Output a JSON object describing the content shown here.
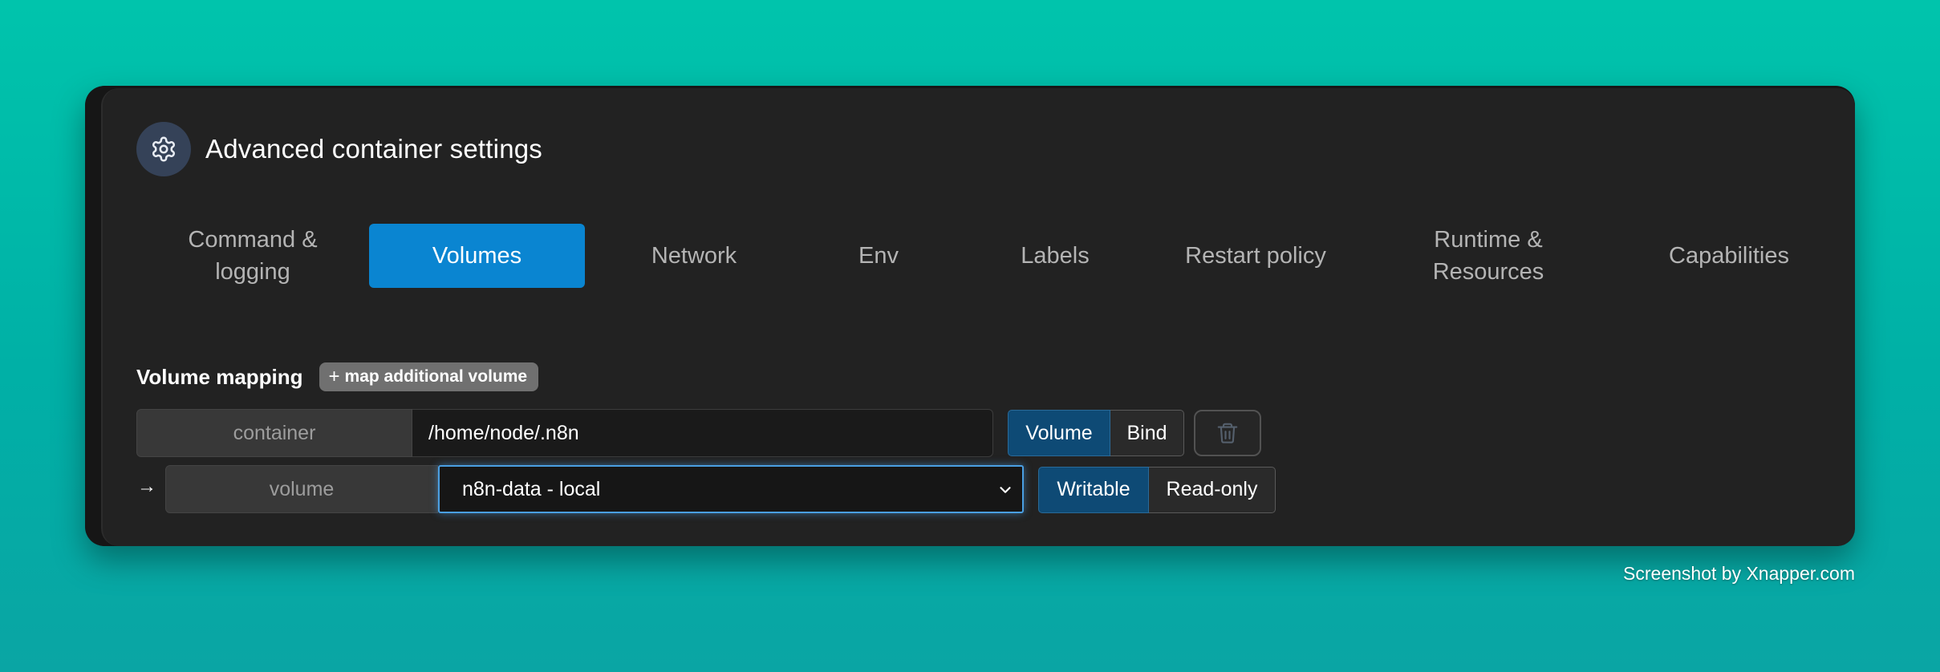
{
  "header": {
    "title": "Advanced container settings",
    "icon": "gear-icon"
  },
  "tabs": [
    {
      "label": "Command &\nlogging",
      "active": false
    },
    {
      "label": "Volumes",
      "active": true
    },
    {
      "label": "Network",
      "active": false
    },
    {
      "label": "Env",
      "active": false
    },
    {
      "label": "Labels",
      "active": false
    },
    {
      "label": "Restart policy",
      "active": false
    },
    {
      "label": "Runtime &\nResources",
      "active": false
    },
    {
      "label": "Capabilities",
      "active": false
    }
  ],
  "volume_mapping": {
    "label": "Volume mapping",
    "add_button": "map additional volume",
    "add_button_icon": "+",
    "row1": {
      "addon": "container",
      "value": "/home/node/.n8n",
      "type_options": [
        "Volume",
        "Bind"
      ],
      "type_selected": "Volume"
    },
    "row2": {
      "arrow": "→",
      "addon": "volume",
      "selected": "n8n-data - local",
      "mode_options": [
        "Writable",
        "Read-only"
      ],
      "mode_selected": "Writable"
    }
  },
  "colors": {
    "accent": "#0a85d1",
    "card_bg": "#222222",
    "selected_segment": "#0e4a75",
    "focus_ring": "#4a9fe3"
  },
  "credit": "Screenshot by Xnapper.com"
}
